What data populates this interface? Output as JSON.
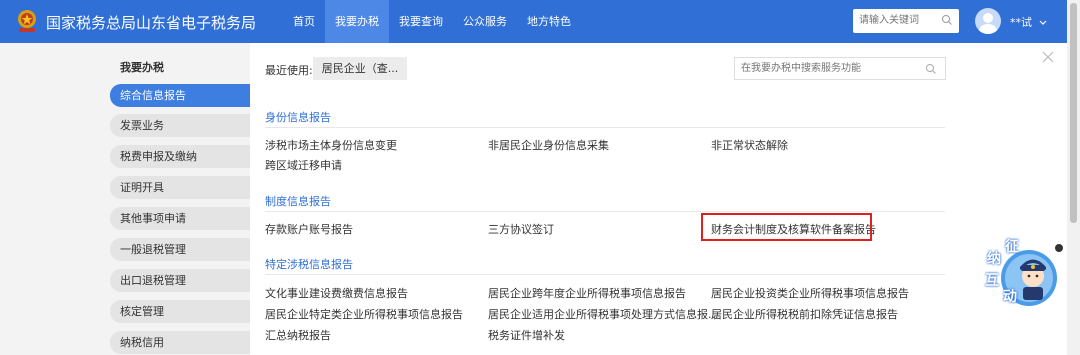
{
  "header": {
    "site_title": "国家税务总局山东省电子税务局",
    "nav": [
      "首页",
      "我要办税",
      "我要查询",
      "公众服务",
      "地方特色"
    ],
    "active_nav": "我要办税",
    "search_placeholder": "请输入关键词",
    "user_name": "**试"
  },
  "sidebar": {
    "title": "我要办税",
    "items": [
      "综合信息报告",
      "发票业务",
      "税费申报及缴纳",
      "证明开具",
      "其他事项申请",
      "一般退税管理",
      "出口退税管理",
      "核定管理",
      "纳税信用"
    ],
    "active_index": 0
  },
  "main": {
    "recent_label": "最近使用:",
    "recent_item": "居民企业（查...",
    "function_search_placeholder": "在我要办税中搜索服务功能",
    "sections": [
      {
        "title": "身份信息报告",
        "links": [
          "涉税市场主体身份信息变更",
          "非居民企业身份信息采集",
          "非正常状态解除",
          "跨区域迁移申请"
        ]
      },
      {
        "title": "制度信息报告",
        "links": [
          "存款账户账号报告",
          "三方协议签订",
          "财务会计制度及核算软件备案报告"
        ]
      },
      {
        "title": "特定涉税信息报告",
        "links": [
          "文化事业建设费缴费信息报告",
          "居民企业跨年度企业所得税事项信息报告",
          "居民企业投资类企业所得税事项信息报告",
          "居民企业特定类企业所得税事项信息报告",
          "居民企业适用企业所得税事项处理方式信息报...",
          "居民企业所得税税前扣除凭证信息报告",
          "汇总纳税报告",
          "税务证件增补发"
        ]
      }
    ],
    "highlighted_link": "财务会计制度及核算软件备案报告"
  },
  "widget": {
    "chars": [
      "纳",
      "征",
      "互",
      "动"
    ]
  },
  "colors": {
    "header_bg": "#2f6fd6",
    "active_nav_bg": "#4d88e6",
    "sidebar_active": "#3d7ee0",
    "section_title": "#2f6fd6",
    "highlight_border": "#e02020"
  }
}
